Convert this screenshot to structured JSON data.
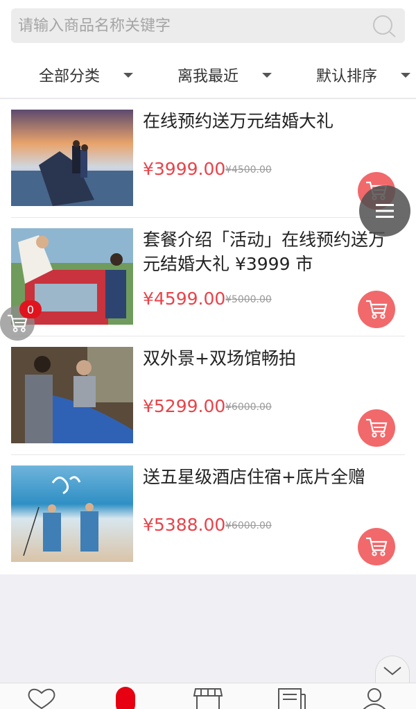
{
  "search": {
    "placeholder": "请输入商品名称关键字"
  },
  "filters": [
    {
      "label": "全部分类"
    },
    {
      "label": "离我最近"
    },
    {
      "label": "默认排序"
    }
  ],
  "products": [
    {
      "title": "在线预约送万元结婚大礼",
      "price": "¥3999.00",
      "old_price": "¥4500.00"
    },
    {
      "title": "套餐介绍「活动」在线预约送万元结婚大礼 ¥3999 市",
      "price": "¥4599.00",
      "old_price": "¥5000.00"
    },
    {
      "title": "双外景+双场馆畅拍",
      "price": "¥5299.00",
      "old_price": "¥6000.00"
    },
    {
      "title": "送五星级酒店住宿+底片全赠",
      "price": "¥5388.00",
      "old_price": "¥6000.00"
    }
  ],
  "cart_badge": "0",
  "colors": {
    "price": "#e8434a",
    "cart_button": "#f1696b",
    "badge": "#e0141e"
  },
  "icons": {
    "search": "search-icon",
    "cart": "cart-icon",
    "menu": "menu-icon",
    "heart": "heart-icon",
    "shop": "shop-icon",
    "news": "news-icon",
    "user": "user-icon",
    "chevron": "chevron-down-icon"
  }
}
